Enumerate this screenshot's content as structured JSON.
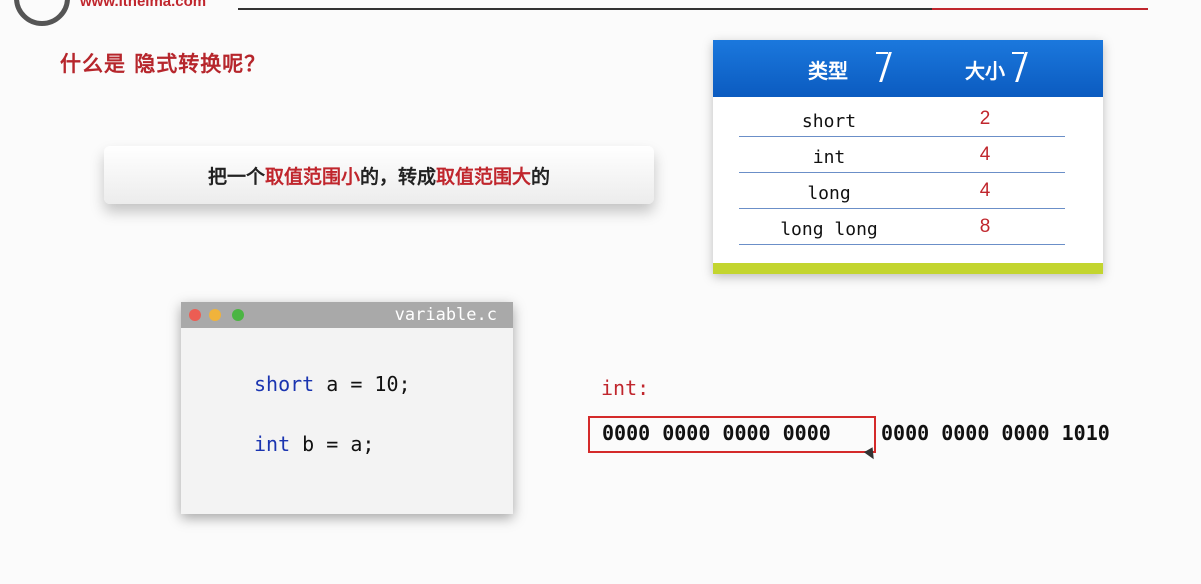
{
  "header": {
    "url": "www.itheima.com"
  },
  "heading": "什么是 隐式转换呢？",
  "banner": {
    "part1": "把一个",
    "part2": "取值范围小",
    "part3": "的，转成",
    "part4": "取值范围大",
    "part5": "的"
  },
  "size_table": {
    "headers": {
      "type": "类型",
      "size": "大小"
    },
    "rows": [
      {
        "type": "short",
        "size": "2"
      },
      {
        "type": "int",
        "size": "4"
      },
      {
        "type": "long",
        "size": "4"
      },
      {
        "type": "long long",
        "size": "8"
      }
    ]
  },
  "code_window": {
    "filename": "variable.c",
    "line1": {
      "keyword": "short",
      "rest": " a = 10;"
    },
    "line2": {
      "keyword": "int",
      "rest": " b = a;"
    }
  },
  "binary": {
    "label": "int:",
    "high_bits": "0000 0000 0000 0000",
    "low_bits": "0000 0000 0000 1010"
  },
  "colors": {
    "accent_red": "#c0262d",
    "table_header_blue": "#1b78dd",
    "table_footer_green": "#c3d52f",
    "keyword_blue": "#1a34b0"
  }
}
